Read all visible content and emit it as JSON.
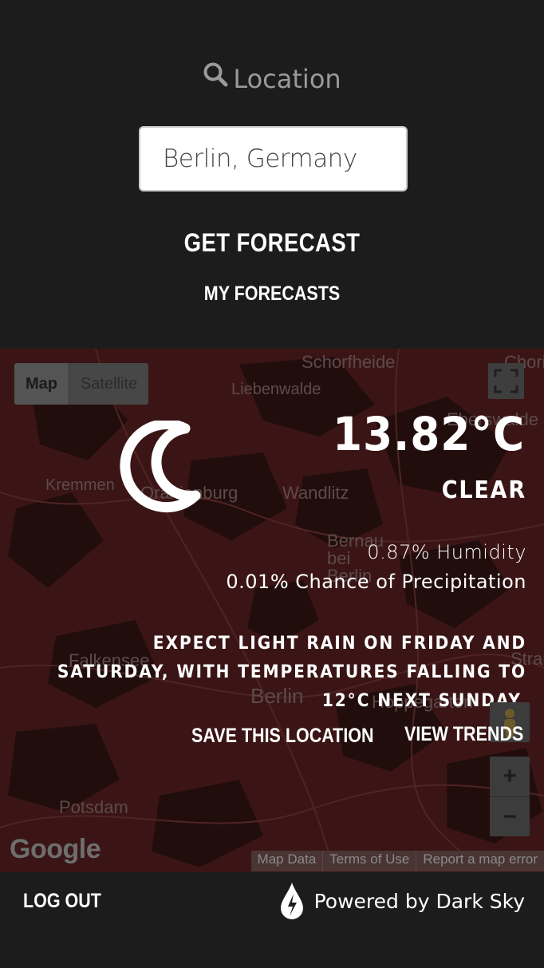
{
  "location_section": {
    "label": "Location",
    "icon": "search-icon",
    "input_value": "Berlin, Germany",
    "get_forecast_label": "GET FORECAST",
    "my_forecasts_label": "MY FORECASTS"
  },
  "map": {
    "type_map_label": "Map",
    "type_satellite_label": "Satellite",
    "place_labels": [
      "Schorfheide",
      "Chorin",
      "Liebenwalde",
      "Eberswalde",
      "Kremmen",
      "Oranienburg",
      "Wandlitz",
      "Bernau bei Berlin",
      "Berlin",
      "Hoppegarten",
      "Falkensee",
      "Potsdam",
      "Strausberg"
    ],
    "footer": [
      "Map Data",
      "Terms of Use",
      "Report a map error"
    ],
    "google_logo": "Google",
    "zoom_in": "+",
    "zoom_out": "−"
  },
  "weather": {
    "icon": "clear-night-moon-icon",
    "temperature": "13.82°C",
    "summary": "CLEAR",
    "humidity": "0.87% Humidity",
    "precipitation": "0.01% Chance of Precipitation",
    "outlook": "EXPECT LIGHT RAIN ON FRIDAY AND SATURDAY, WITH TEMPERATURES FALLING TO 12°C NEXT SUNDAY.",
    "save_label": "SAVE THIS LOCATION",
    "trends_label": "VIEW TRENDS"
  },
  "footer": {
    "logout_label": "LOG OUT",
    "powered_label": "Powered by Dark Sky"
  },
  "colors": {
    "background": "#1c1c1c",
    "map_tint": "#3a1414",
    "text": "#ffffff",
    "muted": "#9a9a9a"
  }
}
